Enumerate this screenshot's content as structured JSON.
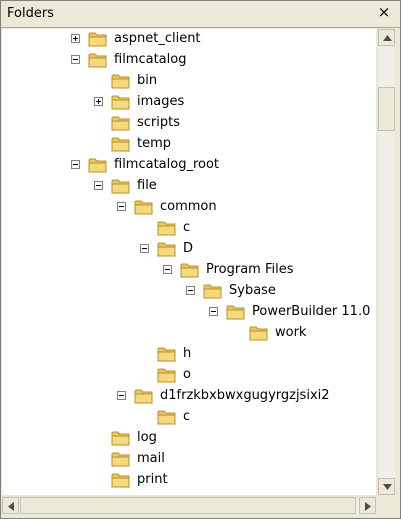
{
  "header": {
    "title": "Folders",
    "close_glyph": "×"
  },
  "tree": {
    "items": [
      {
        "label": "aspnet_client",
        "depth": 0,
        "expander": "plus"
      },
      {
        "label": "filmcatalog",
        "depth": 0,
        "expander": "minus"
      },
      {
        "label": "bin",
        "depth": 1,
        "expander": "none"
      },
      {
        "label": "images",
        "depth": 1,
        "expander": "plus"
      },
      {
        "label": "scripts",
        "depth": 1,
        "expander": "none"
      },
      {
        "label": "temp",
        "depth": 1,
        "expander": "none"
      },
      {
        "label": "filmcatalog_root",
        "depth": 0,
        "expander": "minus"
      },
      {
        "label": "file",
        "depth": 1,
        "expander": "minus"
      },
      {
        "label": "common",
        "depth": 2,
        "expander": "minus"
      },
      {
        "label": "c",
        "depth": 3,
        "expander": "none"
      },
      {
        "label": "D",
        "depth": 3,
        "expander": "minus"
      },
      {
        "label": "Program Files",
        "depth": 4,
        "expander": "minus"
      },
      {
        "label": "Sybase",
        "depth": 5,
        "expander": "minus"
      },
      {
        "label": "PowerBuilder 11.0",
        "depth": 6,
        "expander": "minus"
      },
      {
        "label": "work",
        "depth": 7,
        "expander": "none"
      },
      {
        "label": "h",
        "depth": 3,
        "expander": "none"
      },
      {
        "label": "o",
        "depth": 3,
        "expander": "none"
      },
      {
        "label": "d1frzkbxbwxgugyrgzjsixi2",
        "depth": 2,
        "expander": "minus"
      },
      {
        "label": "c",
        "depth": 3,
        "expander": "none"
      },
      {
        "label": "log",
        "depth": 1,
        "expander": "none"
      },
      {
        "label": "mail",
        "depth": 1,
        "expander": "none"
      },
      {
        "label": "print",
        "depth": 1,
        "expander": "none"
      }
    ]
  },
  "colors": {
    "folder_fill": "#f5d97a",
    "folder_stroke": "#b8922e",
    "folder_tab": "#e9c55a"
  }
}
